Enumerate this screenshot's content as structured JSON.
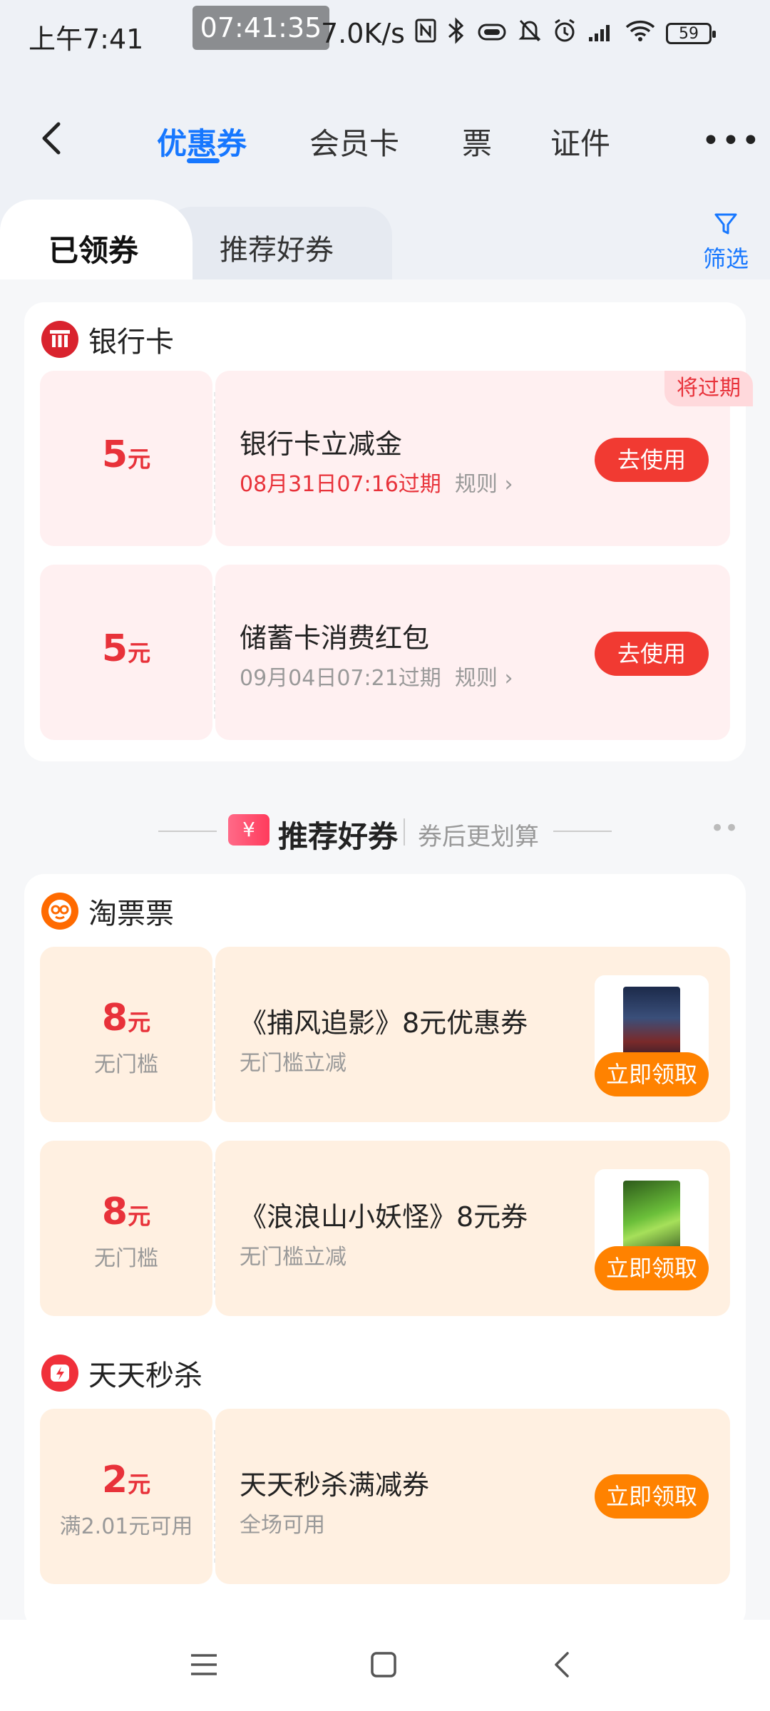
{
  "status_bar": {
    "time": "上午7:41",
    "clock_pill": "07:41:35",
    "net_speed": "7.0K/s",
    "battery": "59",
    "icons": [
      "nfc-icon",
      "bluetooth-icon",
      "vibrate-icon",
      "mute-icon",
      "alarm-icon",
      "signal-icon",
      "wifi-icon",
      "battery-icon"
    ]
  },
  "nav": {
    "back_icon": "chevron-left-icon",
    "tabs": [
      "优惠券",
      "会员卡",
      "票",
      "证件"
    ],
    "active_tab": "优惠券",
    "more_label": "•••"
  },
  "subtabs": {
    "received": "已领券",
    "recommended": "推荐好券",
    "filter_label": "筛选",
    "filter_icon": "funnel-icon"
  },
  "bank_section": {
    "title": "银行卡",
    "coupons": [
      {
        "amount": "5",
        "unit": "元",
        "name": "银行卡立减金",
        "expiry": "08月31日07:16过期",
        "rule": "规则",
        "badge": "将过期",
        "button": "去使用"
      },
      {
        "amount": "5",
        "unit": "元",
        "name": "储蓄卡消费红包",
        "expiry": "09月04日07:21过期",
        "rule": "规则",
        "button": "去使用"
      }
    ]
  },
  "divider": {
    "tag_symbol": "¥",
    "title": "推荐好券",
    "subtitle": "券后更划算",
    "dots": "••"
  },
  "taopiaopiao_section": {
    "title": "淘票票",
    "coupons": [
      {
        "amount": "8",
        "unit": "元",
        "condition": "无门槛",
        "name": "《捕风追影》8元优惠券",
        "desc": "无门槛立减",
        "button": "立即领取"
      },
      {
        "amount": "8",
        "unit": "元",
        "condition": "无门槛",
        "name": "《浪浪山小妖怪》8元券",
        "desc": "无门槛立减",
        "button": "立即领取"
      }
    ]
  },
  "flash_section": {
    "title": "天天秒杀",
    "coupons": [
      {
        "amount": "2",
        "unit": "元",
        "condition": "满2.01元可用",
        "name": "天天秒杀满减券",
        "desc": "全场可用",
        "button": "立即领取"
      }
    ]
  },
  "bottom_nav": [
    "menu-icon",
    "home-square-icon",
    "back-icon"
  ],
  "colors": {
    "accent": "#1677ff",
    "red": "#e8323a",
    "button_red": "#f13a32",
    "button_orange": "#ff8200",
    "pink_bg": "#fff0f1",
    "peach_bg": "#fff0e1"
  }
}
